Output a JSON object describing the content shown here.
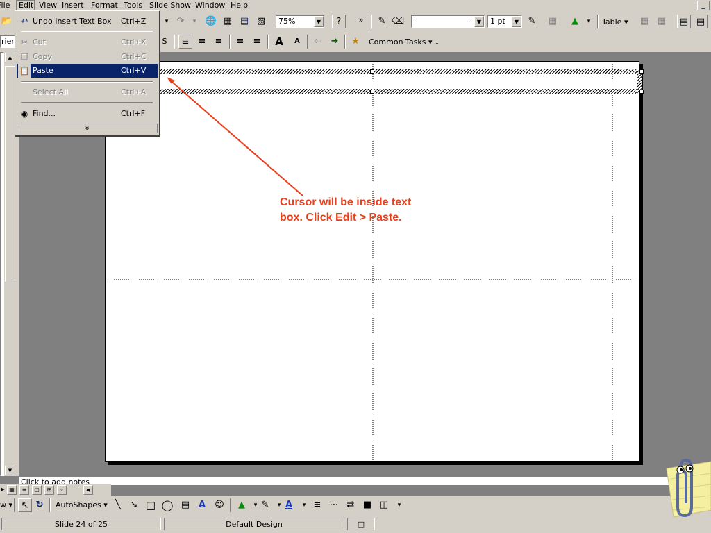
{
  "menubar": {
    "items": [
      "File",
      "Edit",
      "View",
      "Insert",
      "Format",
      "Tools",
      "Slide Show",
      "Window",
      "Help"
    ]
  },
  "toolbar": {
    "zoom_value": "75%",
    "line_weight": "1 pt",
    "table_label": "Table",
    "common_tasks_label": "Common Tasks",
    "font_name": "rier N"
  },
  "edit_menu": {
    "items": [
      {
        "label": "Undo Insert Text Box",
        "shortcut": "Ctrl+Z",
        "icon": "undo-icon",
        "enabled": true
      },
      {
        "label": "Cut",
        "shortcut": "Ctrl+X",
        "icon": "scissors-icon",
        "enabled": false
      },
      {
        "label": "Copy",
        "shortcut": "Ctrl+C",
        "icon": "copy-icon",
        "enabled": false
      },
      {
        "label": "Paste",
        "shortcut": "Ctrl+V",
        "icon": "paste-icon",
        "enabled": true,
        "selected": true
      },
      {
        "label": "Select All",
        "shortcut": "Ctrl+A",
        "icon": "",
        "enabled": false
      },
      {
        "label": "Find...",
        "shortcut": "Ctrl+F",
        "icon": "binoculars-icon",
        "enabled": true
      }
    ],
    "expand_glyph": "»"
  },
  "slide": {
    "callout_line1": "Cursor will be inside text",
    "callout_line2": "box.  Click Edit > Paste.",
    "callout_color": "#e8401c"
  },
  "notes": {
    "placeholder": "Click to add notes"
  },
  "drawing_toolbar": {
    "autoshapes_label": "AutoShapes"
  },
  "statusbar": {
    "slide_position": "Slide 24 of 25",
    "design_name": "Default Design"
  },
  "colors": {
    "chrome": "#d4d0c8",
    "workspace": "#808080",
    "selection": "#0a246a"
  }
}
